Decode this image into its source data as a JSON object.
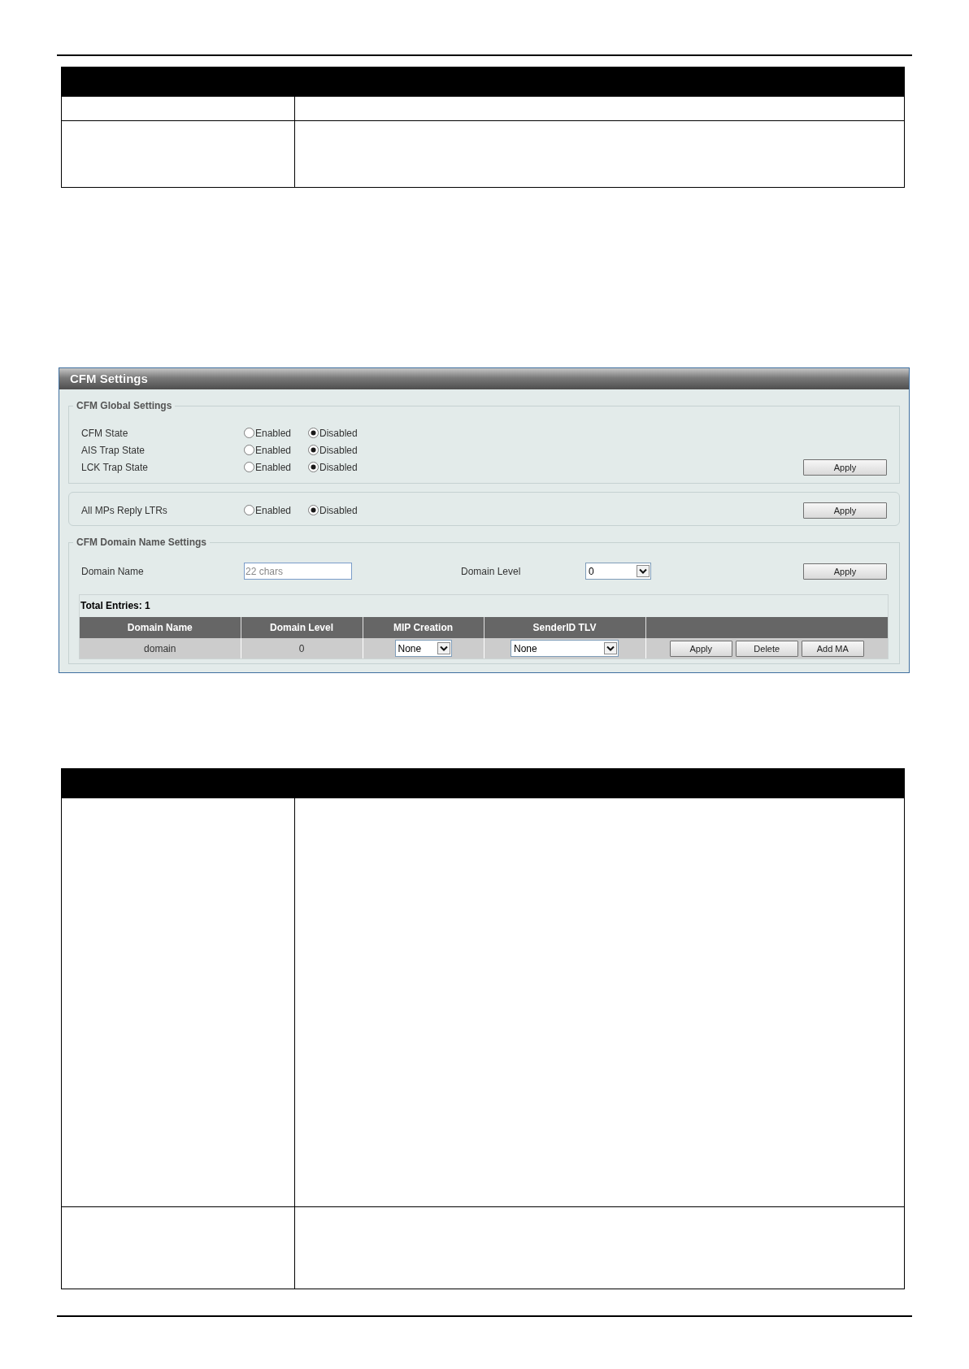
{
  "panel": {
    "title": "CFM Settings",
    "global_settings": {
      "legend": "CFM Global Settings",
      "rows": [
        {
          "label": "CFM State",
          "options": [
            {
              "label": "Enabled",
              "selected": false
            },
            {
              "label": "Disabled",
              "selected": true
            }
          ]
        },
        {
          "label": "AIS Trap State",
          "options": [
            {
              "label": "Enabled",
              "selected": false
            },
            {
              "label": "Disabled",
              "selected": true
            }
          ]
        },
        {
          "label": "LCK Trap State",
          "options": [
            {
              "label": "Enabled",
              "selected": false
            },
            {
              "label": "Disabled",
              "selected": true
            }
          ]
        }
      ],
      "apply": "Apply"
    },
    "ltr_settings": {
      "rows": [
        {
          "label": "All MPs Reply LTRs",
          "options": [
            {
              "label": "Enabled",
              "selected": false
            },
            {
              "label": "Disabled",
              "selected": true
            }
          ]
        }
      ],
      "apply": "Apply"
    },
    "domain_settings": {
      "legend": "CFM Domain Name Settings",
      "domain_name": {
        "label": "Domain Name",
        "placeholder": "22 chars"
      },
      "domain_level": {
        "label": "Domain Level",
        "value": "0"
      },
      "apply": "Apply",
      "total_entries": "Total Entries: 1",
      "table": {
        "columns": [
          "Domain Name",
          "Domain Level",
          "MIP Creation",
          "SenderID TLV"
        ],
        "rows": [
          {
            "domain_name": "domain",
            "domain_level": "0",
            "mip_creation": "None",
            "sender_id_tlv": "None",
            "actions": [
              "Apply",
              "Delete",
              "Add MA"
            ]
          }
        ]
      }
    }
  }
}
